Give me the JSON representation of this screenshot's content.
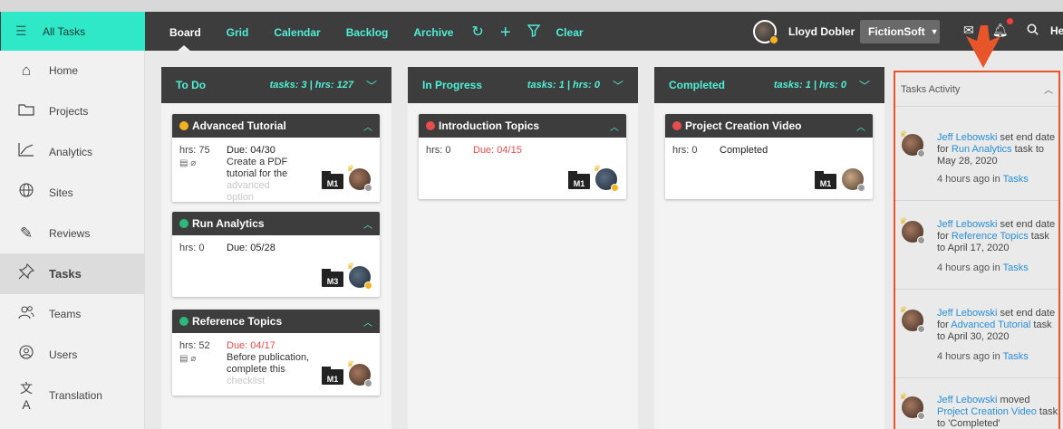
{
  "topbar": {
    "all_tasks_label": "All Tasks",
    "nav": [
      "Board",
      "Grid",
      "Calendar",
      "Backlog",
      "Archive"
    ],
    "clear_label": "Clear",
    "user_name": "Lloyd Dobler",
    "org_name": "FictionSoft",
    "help_label": "He"
  },
  "sidebar": {
    "items": [
      {
        "label": "Home",
        "icon": "home-icon"
      },
      {
        "label": "Projects",
        "icon": "folder-icon"
      },
      {
        "label": "Analytics",
        "icon": "chart-icon"
      },
      {
        "label": "Sites",
        "icon": "globe-icon"
      },
      {
        "label": "Reviews",
        "icon": "pen-icon"
      },
      {
        "label": "Tasks",
        "icon": "pin-icon"
      },
      {
        "label": "Teams",
        "icon": "team-icon"
      },
      {
        "label": "Users",
        "icon": "user-icon"
      },
      {
        "label": "Translation",
        "icon": "translate-icon"
      }
    ]
  },
  "columns": [
    {
      "title": "To Do",
      "stats": "tasks: 3 | hrs: 127"
    },
    {
      "title": "In Progress",
      "stats": "tasks: 1 | hrs: 0"
    },
    {
      "title": "Completed",
      "stats": "tasks: 1 | hrs: 0"
    }
  ],
  "cards": {
    "advanced": {
      "title": "Advanced Tutorial",
      "hrs": "hrs: 75",
      "due": "Due: 04/30",
      "desc": "Create a PDF tutorial for the",
      "desc_fade": "advanced option",
      "tag": "M1",
      "status_color": "#f3b21f"
    },
    "analytics": {
      "title": "Run Analytics",
      "hrs": "hrs: 0",
      "due": "Due: 05/28",
      "tag": "M3",
      "status_color": "#2eb87a"
    },
    "reference": {
      "title": "Reference Topics",
      "hrs": "hrs: 52",
      "due": "Due: 04/17",
      "desc": "Before publication, complete this",
      "desc_fade": "checklist",
      "tag": "M1",
      "status_color": "#2eb87a"
    },
    "intro": {
      "title": "Introduction Topics",
      "hrs": "hrs: 0",
      "due": "Due: 04/15",
      "tag": "M1",
      "status_color": "#e84c4c"
    },
    "video": {
      "title": "Project Creation Video",
      "hrs": "hrs: 0",
      "due": "Completed",
      "tag": "M1",
      "status_color": "#e84c4c"
    }
  },
  "activity": {
    "title": "Tasks Activity",
    "items": [
      {
        "user": "Jeff Lebowski",
        "action": " set end date for ",
        "task": "Run Analytics",
        "rest": " task to May 28, 2020",
        "time": "4 hours ago in ",
        "where": "Tasks"
      },
      {
        "user": "Jeff Lebowski",
        "action": " set end date for ",
        "task": "Reference Topics",
        "rest": " task to April 17, 2020",
        "time": "4 hours ago in ",
        "where": "Tasks"
      },
      {
        "user": "Jeff Lebowski",
        "action": " set end date for ",
        "task": "Advanced Tutorial",
        "rest": " task to April 30, 2020",
        "time": "4 hours ago in ",
        "where": "Tasks"
      },
      {
        "user": "Jeff Lebowski",
        "action": " moved ",
        "task": "Project Creation Video",
        "rest": " task to 'Completed'",
        "time": "",
        "where": ""
      }
    ]
  },
  "colors": {
    "accent": "#4ff0d6",
    "annotation": "#e8552a",
    "link": "#2a8fd6"
  }
}
